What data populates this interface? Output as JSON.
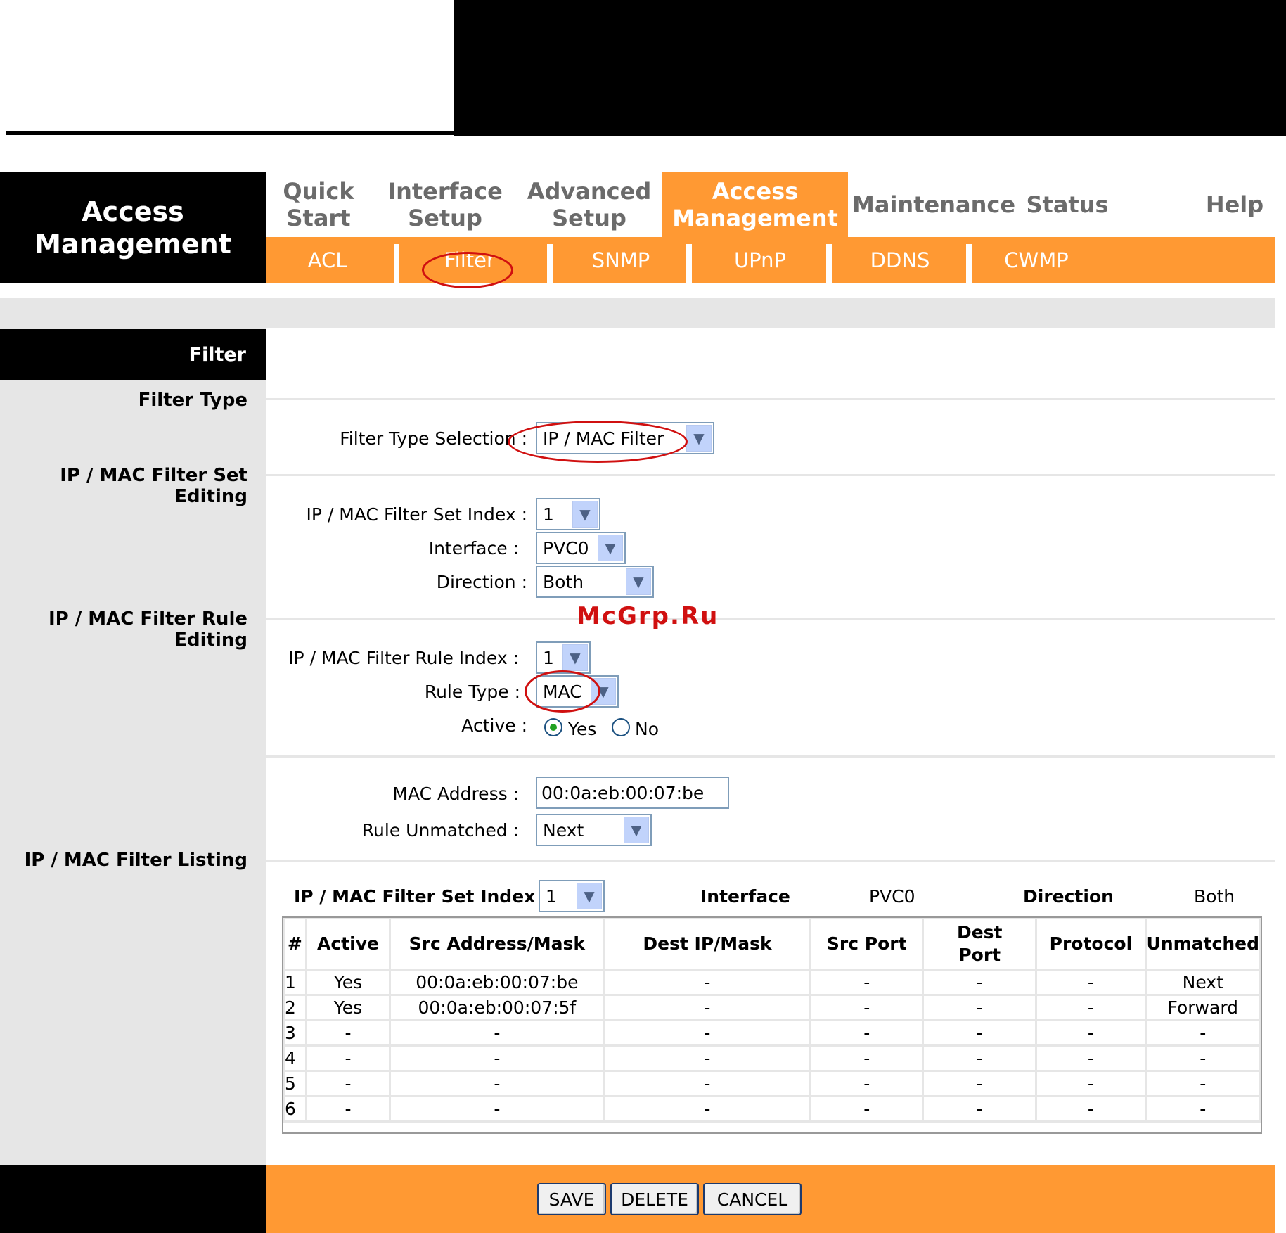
{
  "brand": {
    "line1": "Access",
    "line2": "Management"
  },
  "nav": {
    "tabs": [
      {
        "l1": "Quick",
        "l2": "Start"
      },
      {
        "l1": "Interface",
        "l2": "Setup"
      },
      {
        "l1": "Advanced",
        "l2": "Setup"
      },
      {
        "l1": "Access",
        "l2": "Management"
      },
      {
        "l1": "Maintenance",
        "l2": ""
      },
      {
        "l1": "Status",
        "l2": ""
      },
      {
        "l1": "Help",
        "l2": ""
      }
    ],
    "active_tab": "Access Management",
    "subtabs": [
      "ACL",
      "Filter",
      "SNMP",
      "UPnP",
      "DDNS",
      "CWMP"
    ],
    "active_subtab": "Filter"
  },
  "sections": {
    "filter": "Filter",
    "filter_type": "Filter Type",
    "set_editing": "IP / MAC Filter Set Editing",
    "rule_editing": "IP / MAC Filter Rule Editing",
    "listing": "IP / MAC Filter Listing"
  },
  "form": {
    "filter_type_label": "Filter Type Selection :",
    "filter_type_value": "IP / MAC Filter",
    "set_index_label": "IP / MAC Filter Set Index :",
    "set_index_value": "1",
    "interface_label": "Interface :",
    "interface_value": "PVC0",
    "direction_label": "Direction :",
    "direction_value": "Both",
    "rule_index_label": "IP / MAC Filter Rule Index :",
    "rule_index_value": "1",
    "rule_type_label": "Rule Type :",
    "rule_type_value": "MAC",
    "active_label": "Active :",
    "active_yes": "Yes",
    "active_no": "No",
    "mac_label": "MAC Address :",
    "mac_value": "00:0a:eb:00:07:be",
    "unmatched_label": "Rule Unmatched :",
    "unmatched_value": "Next"
  },
  "listing": {
    "set_index_label": "IP / MAC Filter Set Index",
    "set_index_value": "1",
    "interface_label": "Interface",
    "interface_value": "PVC0",
    "direction_label": "Direction",
    "direction_value": "Both",
    "headers": [
      "#",
      "Active",
      "Src Address/Mask",
      "Dest IP/Mask",
      "Src Port",
      "Dest Port",
      "Protocol",
      "Unmatched"
    ],
    "rows": [
      [
        "1",
        "Yes",
        "00:0a:eb:00:07:be",
        "-",
        "-",
        "-",
        "-",
        "Next"
      ],
      [
        "2",
        "Yes",
        "00:0a:eb:00:07:5f",
        "-",
        "-",
        "-",
        "-",
        "Forward"
      ],
      [
        "3",
        "-",
        "-",
        "-",
        "-",
        "-",
        "-",
        "-"
      ],
      [
        "4",
        "-",
        "-",
        "-",
        "-",
        "-",
        "-",
        "-"
      ],
      [
        "5",
        "-",
        "-",
        "-",
        "-",
        "-",
        "-",
        "-"
      ],
      [
        "6",
        "-",
        "-",
        "-",
        "-",
        "-",
        "-",
        "-"
      ]
    ]
  },
  "buttons": {
    "save": "SAVE",
    "delete": "DELETE",
    "cancel": "CANCEL"
  },
  "watermark": "McGrp.Ru",
  "colors": {
    "accent": "#ff9933",
    "panel_gray": "#e6e6e6",
    "annotation_red": "#d01010"
  }
}
